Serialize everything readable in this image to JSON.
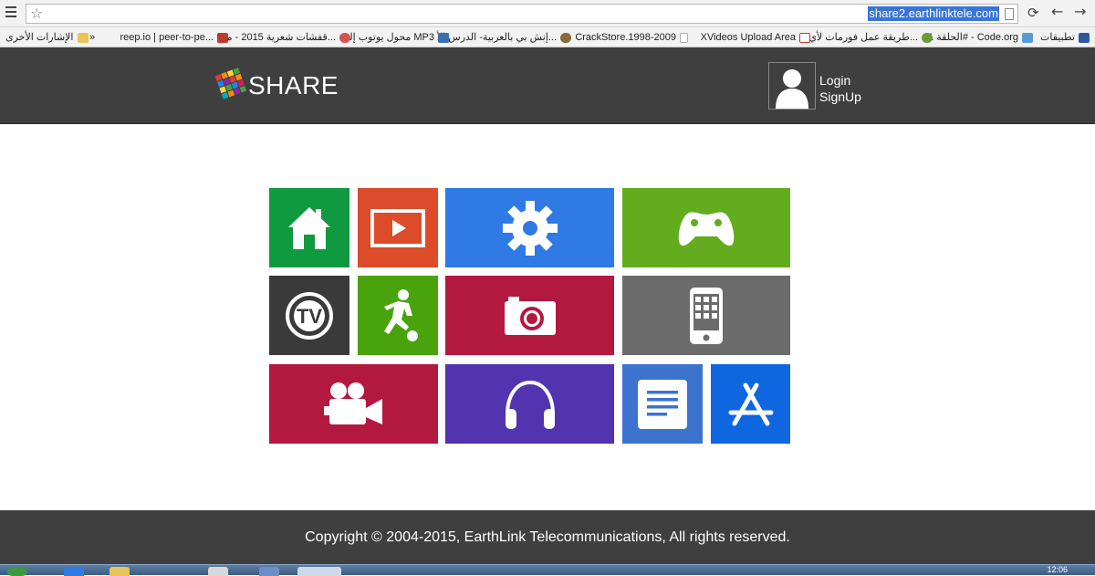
{
  "browser": {
    "url": "share2.earthlinktele.com",
    "icons": [
      "menu-icon",
      "star-icon",
      "page-icon",
      "reload-icon",
      "back-icon",
      "forward-icon"
    ]
  },
  "bookmarks": [
    {
      "label": "تطبيقات",
      "icon": "apps-icon",
      "color": "#2c5aa0"
    },
    {
      "label": "الحلقة 1# - Code.org",
      "icon": "bookmark-icon",
      "color": "#5b9bd5"
    },
    {
      "label": "طريقة عمل فورمات لأي ج...",
      "icon": "bookmark-icon",
      "color": "#6a9a3a"
    },
    {
      "label": "XVideos Upload Area",
      "icon": "xv-icon",
      "color": "#c0392b"
    },
    {
      "label": "CrackStore.1998-2009",
      "icon": "page-icon",
      "color": "#cccccc"
    },
    {
      "label": "إنش بي بالعربية- الدرس الأ...",
      "icon": "bookmark-icon",
      "color": "#8a6a3a"
    },
    {
      "label": "محول يوتوب إلى MP3",
      "icon": "yt-icon",
      "color": "#3a6fb0"
    },
    {
      "label": "قفشات شعرية 2015 - من...",
      "icon": "heart-icon",
      "color": "#d9534f"
    },
    {
      "label": "reep.io | peer-to-pe...",
      "icon": "cube-icon",
      "color": "#c0392b"
    },
    {
      "label": "»",
      "icon": "",
      "color": ""
    },
    {
      "label": "الإشارات الأخرى",
      "icon": "folder-icon",
      "color": "#e8c35a"
    }
  ],
  "header": {
    "logo_text": "SHARE",
    "login_label": "Login",
    "signup_label": "SignUp"
  },
  "tiles": [
    {
      "id": "home",
      "icon": "home-icon",
      "color": "#0f9a3f"
    },
    {
      "id": "video",
      "icon": "video-player-icon",
      "color": "#dc4b2a"
    },
    {
      "id": "settings",
      "icon": "gear-icon",
      "color": "#2f7ae5"
    },
    {
      "id": "games",
      "icon": "gamepad-icon",
      "color": "#62ac1d"
    },
    {
      "id": "tv",
      "icon": "tv-icon",
      "color": "#3a3a3a"
    },
    {
      "id": "sports",
      "icon": "soccer-player-icon",
      "color": "#4aa30d"
    },
    {
      "id": "photos",
      "icon": "camera-icon",
      "color": "#b3183e"
    },
    {
      "id": "apple-apps",
      "icon": "iphone-icon",
      "color": "#6b6b6b"
    },
    {
      "id": "movies",
      "icon": "video-camera-icon",
      "color": "#b3183e"
    },
    {
      "id": "music",
      "icon": "headphones-icon",
      "color": "#5233b0"
    },
    {
      "id": "documents",
      "icon": "document-icon",
      "color": "#3b73cf"
    },
    {
      "id": "app-store",
      "icon": "app-store-icon",
      "color": "#0e66e0"
    }
  ],
  "footer": {
    "copyright": "Copyright © 2004-2015, EarthLink Telecommunications, All rights reserved."
  },
  "taskbar": {
    "clock": "12:06"
  }
}
